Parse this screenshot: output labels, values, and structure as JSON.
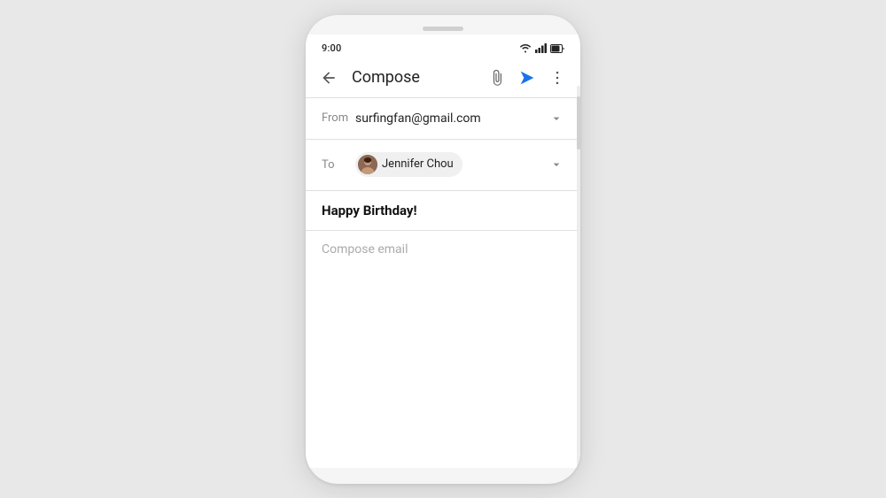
{
  "phone": {
    "status_bar": {
      "time": "9:00",
      "wifi_label": "wifi-icon",
      "signal_label": "signal-icon",
      "battery_label": "battery-icon"
    },
    "app_bar": {
      "back_label": "back-arrow-icon",
      "title": "Compose",
      "attach_label": "attach-icon",
      "send_label": "send-icon",
      "more_label": "more-vert-icon"
    },
    "from_row": {
      "label": "From",
      "value": "surfingfan@gmail.com",
      "chevron_label": "chevron-down-icon"
    },
    "to_row": {
      "label": "To",
      "recipient_name": "Jennifer Chou",
      "chevron_label": "chevron-down-icon"
    },
    "subject_row": {
      "value": "Happy Birthday!"
    },
    "body_row": {
      "placeholder": "Compose email"
    }
  }
}
